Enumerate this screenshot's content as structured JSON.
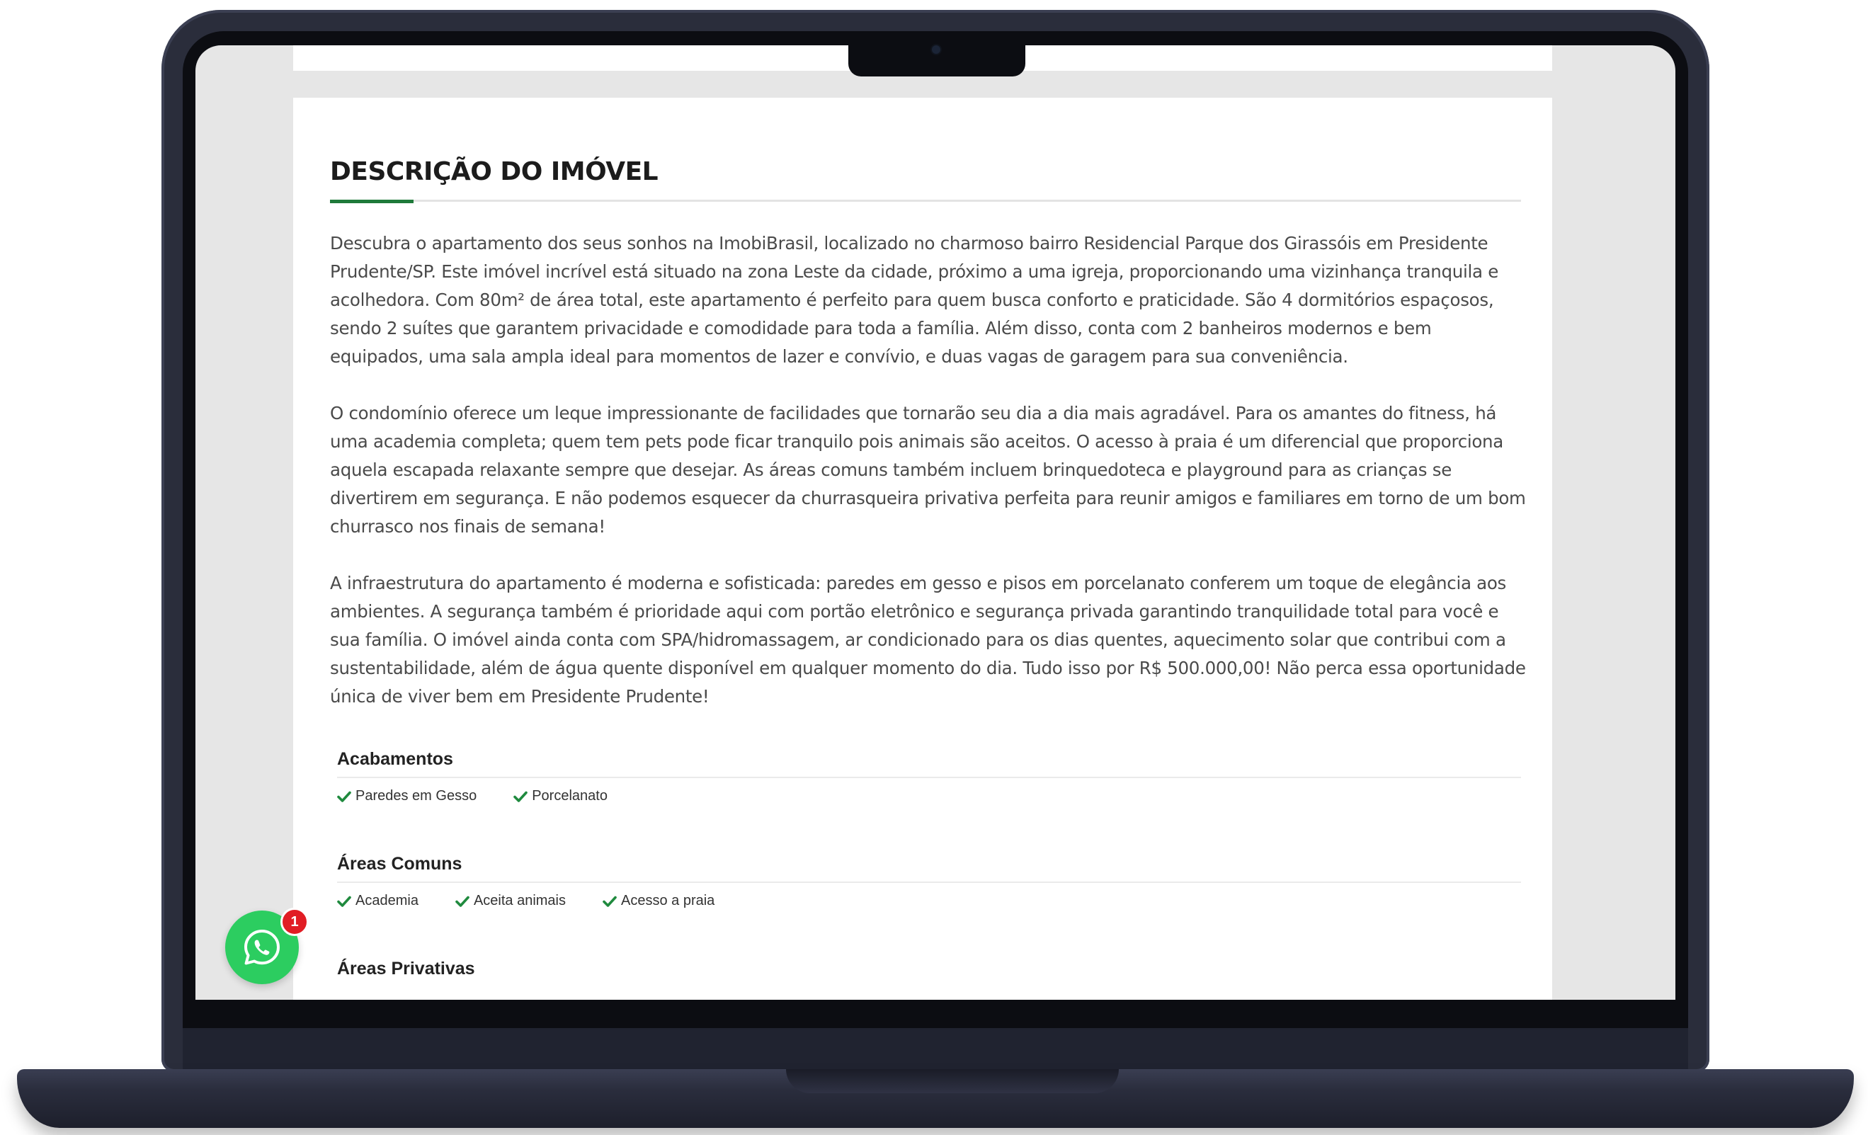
{
  "section": {
    "title": "DESCRIÇÃO DO IMÓVEL",
    "paragraphs": [
      "Descubra o apartamento dos seus sonhos na ImobiBrasil, localizado no charmoso bairro Residencial Parque dos Girassóis em Presidente Prudente/SP. Este imóvel incrível está situado na zona Leste da cidade, próximo a uma igreja, proporcionando uma vizinhança tranquila e acolhedora. Com 80m² de área total, este apartamento é perfeito para quem busca conforto e praticidade. São 4 dormitórios espaçosos, sendo 2 suítes que garantem privacidade e comodidade para toda a família. Além disso, conta com 2 banheiros modernos e bem equipados, uma sala ampla ideal para momentos de lazer e convívio, e duas vagas de garagem para sua conveniência.",
      "O condomínio oferece um leque impressionante de facilidades que tornarão seu dia a dia mais agradável. Para os amantes do fitness, há uma academia completa; quem tem pets pode ficar tranquilo pois animais são aceitos. O acesso à praia é um diferencial que proporciona aquela escapada relaxante sempre que desejar. As áreas comuns também incluem brinquedoteca e playground para as crianças se divertirem em segurança. E não podemos esquecer da churrasqueira privativa perfeita para reunir amigos e familiares em torno de um bom churrasco nos finais de semana!",
      "A infraestrutura do apartamento é moderna e sofisticada: paredes em gesso e pisos em porcelanato conferem um toque de elegância aos ambientes. A segurança também é prioridade aqui com portão eletrônico e segurança privada garantindo tranquilidade total para você e sua família. O imóvel ainda conta com SPA/hidromassagem, ar condicionado para os dias quentes, aquecimento solar que contribui com a sustentabilidade, além de água quente disponível em qualquer momento do dia. Tudo isso por R$ 500.000,00! Não perca essa oportunidade única de viver bem em Presidente Prudente!"
    ]
  },
  "features": [
    {
      "title": "Acabamentos",
      "items": [
        "Paredes em Gesso",
        "Porcelanato"
      ]
    },
    {
      "title": "Áreas Comuns",
      "items": [
        "Academia",
        "Aceita animais",
        "Acesso a praia"
      ]
    },
    {
      "title": "Áreas Privativas",
      "items": []
    }
  ],
  "whatsapp": {
    "badge_count": "1"
  },
  "colors": {
    "accent": "#1f7a3a",
    "check": "#1f8a3e",
    "whatsapp": "#2ccd60",
    "badge": "#e11d24",
    "laptop_frame": "#2a2d3b"
  },
  "icons": {
    "check": "check-icon",
    "whatsapp": "whatsapp-icon"
  }
}
